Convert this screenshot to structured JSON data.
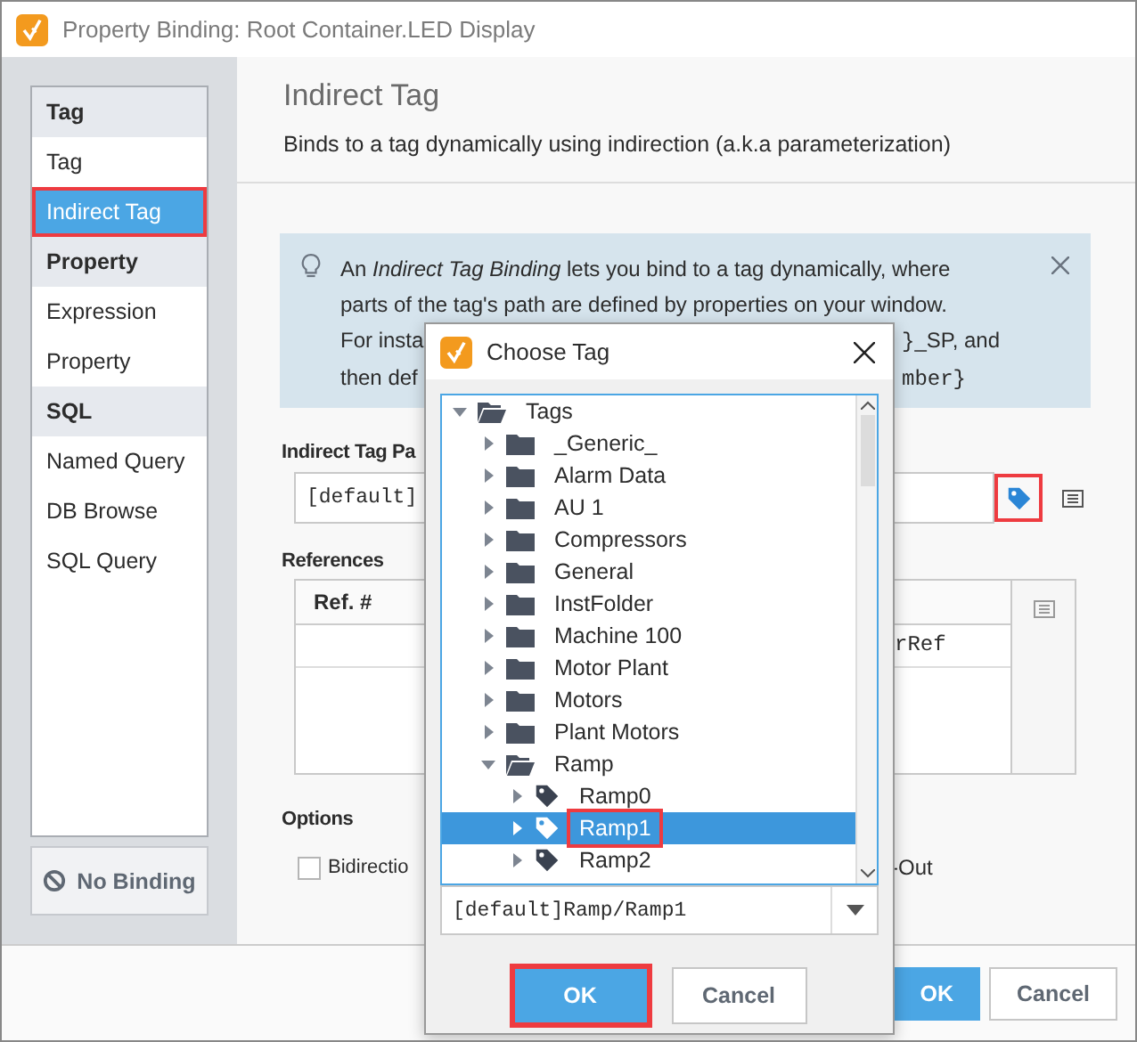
{
  "window": {
    "title": "Property Binding: Root Container.LED Display"
  },
  "sidebar": {
    "groups": [
      {
        "label": "Tag",
        "items": [
          {
            "label": "Tag",
            "selected": false,
            "highlighted": false
          },
          {
            "label": "Indirect Tag",
            "selected": true,
            "highlighted": true
          }
        ]
      },
      {
        "label": "Property",
        "items": [
          {
            "label": "Expression",
            "selected": false,
            "highlighted": false
          },
          {
            "label": "Property",
            "selected": false,
            "highlighted": false
          }
        ]
      },
      {
        "label": "SQL",
        "items": [
          {
            "label": "Named Query",
            "selected": false,
            "highlighted": false
          },
          {
            "label": "DB Browse",
            "selected": false,
            "highlighted": false
          },
          {
            "label": "SQL Query",
            "selected": false,
            "highlighted": false
          }
        ]
      }
    ],
    "no_binding_button": "No Binding"
  },
  "panel": {
    "title": "Indirect Tag",
    "description": "Binds to a tag dynamically using indirection (a.k.a parameterization)",
    "info": {
      "lines": [
        {
          "left": [
            {
              "text": "An *Indirect Tag Binding* lets you bind to a tag dynamically, where",
              "code": false
            }
          ]
        },
        {
          "left": [
            {
              "text": "parts of the tag's path are defined by properties on your window.",
              "code": false
            }
          ]
        },
        {
          "left": [
            {
              "text": "For insta",
              "code": false
            }
          ],
          "right": [
            {
              "text": "}",
              "code": true
            },
            {
              "text": "_SP, and",
              "code": false
            }
          ]
        },
        {
          "left": [
            {
              "text": "then def",
              "code": false
            }
          ],
          "right": [
            {
              "text": "mber}",
              "code": true
            }
          ]
        }
      ]
    },
    "path_label": "Indirect Tag Pa",
    "path_value": "[default]",
    "browse_highlighted": true,
    "references_label": "References",
    "references": {
      "columns": [
        "Ref. #"
      ],
      "rows": [
        {
          "column_2": "rRef"
        }
      ]
    },
    "options_label": "Options",
    "options": [
      {
        "label": "Bidirectio",
        "checked": false
      }
    ],
    "options_right": "-Out"
  },
  "buttons": [
    {
      "label": "OK",
      "kind": "primary"
    },
    {
      "label": "Cancel",
      "kind": "secondary"
    }
  ],
  "dialog": {
    "title": "Choose Tag",
    "tree": [
      {
        "label": "Tags",
        "kind": "folder",
        "expanded": true,
        "selected": false,
        "highlighted": false,
        "children": [
          {
            "label": "_Generic_",
            "kind": "folder",
            "expanded": false,
            "selected": false,
            "highlighted": false
          },
          {
            "label": "Alarm Data",
            "kind": "folder",
            "expanded": false,
            "selected": false,
            "highlighted": false
          },
          {
            "label": "AU 1",
            "kind": "folder",
            "expanded": false,
            "selected": false,
            "highlighted": false
          },
          {
            "label": "Compressors",
            "kind": "folder",
            "expanded": false,
            "selected": false,
            "highlighted": false
          },
          {
            "label": "General",
            "kind": "folder",
            "expanded": false,
            "selected": false,
            "highlighted": false
          },
          {
            "label": "InstFolder",
            "kind": "folder",
            "expanded": false,
            "selected": false,
            "highlighted": false
          },
          {
            "label": "Machine 100",
            "kind": "folder",
            "expanded": false,
            "selected": false,
            "highlighted": false
          },
          {
            "label": "Motor Plant",
            "kind": "folder",
            "expanded": false,
            "selected": false,
            "highlighted": false
          },
          {
            "label": "Motors",
            "kind": "folder",
            "expanded": false,
            "selected": false,
            "highlighted": false
          },
          {
            "label": "Plant Motors",
            "kind": "folder",
            "expanded": false,
            "selected": false,
            "highlighted": false
          },
          {
            "label": "Ramp",
            "kind": "folder",
            "expanded": true,
            "selected": false,
            "highlighted": false,
            "children": [
              {
                "label": "Ramp0",
                "kind": "tag",
                "expanded": false,
                "selected": false,
                "highlighted": false
              },
              {
                "label": "Ramp1",
                "kind": "tag",
                "expanded": false,
                "selected": true,
                "highlighted": true
              },
              {
                "label": "Ramp2",
                "kind": "tag",
                "expanded": false,
                "selected": false,
                "highlighted": false
              }
            ]
          }
        ]
      }
    ],
    "path_value": "[default]Ramp/Ramp1",
    "buttons": [
      {
        "label": "OK",
        "kind": "primary",
        "highlighted": true
      },
      {
        "label": "Cancel",
        "kind": "secondary",
        "highlighted": false
      }
    ]
  }
}
